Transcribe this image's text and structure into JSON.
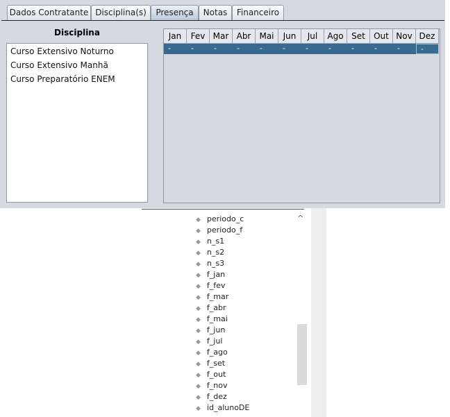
{
  "tabs": [
    "Dados Contratante",
    "Disciplina(s)",
    "Presença",
    "Notas",
    "Financeiro"
  ],
  "selected_tab": "Presença",
  "disciplina": {
    "title": "Disciplina",
    "items": [
      "Curso Extensivo Noturno",
      "Curso Extensivo Manhã",
      "Curso Preparatório ENEM"
    ]
  },
  "grid": {
    "headers": [
      "Jan",
      "Fev",
      "Mar",
      "Abr",
      "Mai",
      "Jun",
      "Jul",
      "Ago",
      "Set",
      "Out",
      "Nov",
      "Dez"
    ],
    "row": [
      "-",
      "-",
      "-",
      "-",
      "-",
      "-",
      "-",
      "-",
      "-",
      "-",
      "-",
      "-"
    ]
  },
  "fields": [
    "periodo_c",
    "periodo_f",
    "n_s1",
    "n_s2",
    "n_s3",
    "f_jan",
    "f_fev",
    "f_mar",
    "f_abr",
    "f_mai",
    "f_jun",
    "f_jul",
    "f_ago",
    "f_set",
    "f_out",
    "f_nov",
    "f_dez",
    "id_alunoDE"
  ]
}
